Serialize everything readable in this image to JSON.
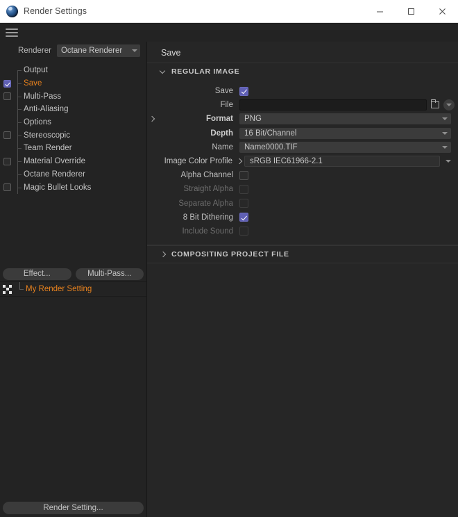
{
  "window": {
    "title": "Render Settings",
    "logo_icon": "cinema4d-logo-icon",
    "minimize_icon": "minimize-icon",
    "maximize_icon": "maximize-icon",
    "close_icon": "close-icon",
    "menu_icon": "hamburger-menu-icon"
  },
  "renderer": {
    "label": "Renderer",
    "value": "Octane Renderer",
    "caret_icon": "chevron-down-icon"
  },
  "tree": {
    "items": [
      {
        "label": "Output",
        "checkbox": "none",
        "active": false
      },
      {
        "label": "Save",
        "checkbox": "checked",
        "active": true
      },
      {
        "label": "Multi-Pass",
        "checkbox": "unchecked",
        "active": false
      },
      {
        "label": "Anti-Aliasing",
        "checkbox": "none",
        "active": false
      },
      {
        "label": "Options",
        "checkbox": "none",
        "active": false
      },
      {
        "label": "Stereoscopic",
        "checkbox": "unchecked",
        "active": false
      },
      {
        "label": "Team Render",
        "checkbox": "none",
        "active": false
      },
      {
        "label": "Material Override",
        "checkbox": "unchecked",
        "active": false
      },
      {
        "label": "Octane Renderer",
        "checkbox": "none",
        "active": false
      },
      {
        "label": "Magic Bullet Looks",
        "checkbox": "unchecked",
        "active": false
      }
    ]
  },
  "left_buttons": {
    "effect": "Effect...",
    "multipass": "Multi-Pass..."
  },
  "render_setting": {
    "name": "My Render Setting",
    "icon": "render-setting-icon",
    "accent_color": "#e8821e"
  },
  "bottom_button": {
    "label": "Render Setting..."
  },
  "main": {
    "title": "Save",
    "sections": [
      {
        "label": "REGULAR IMAGE",
        "expanded": true
      },
      {
        "label": "COMPOSITING PROJECT FILE",
        "expanded": false
      }
    ],
    "fields": {
      "save": {
        "label": "Save",
        "checked": true
      },
      "file": {
        "label": "File",
        "value": "",
        "placeholder": "",
        "folder_icon": "folder-icon",
        "caret_icon": "chevron-down-icon"
      },
      "format": {
        "label": "Format",
        "value": "PNG",
        "expandable": true
      },
      "depth": {
        "label": "Depth",
        "value": "16 Bit/Channel"
      },
      "name": {
        "label": "Name",
        "value": "Name0000.TIF"
      },
      "color_profile": {
        "label": "Image Color Profile",
        "value": "sRGB IEC61966-2.1",
        "expandable": true
      },
      "alpha_channel": {
        "label": "Alpha Channel",
        "checked": false,
        "disabled": false
      },
      "straight_alpha": {
        "label": "Straight Alpha",
        "checked": false,
        "disabled": true
      },
      "separate_alpha": {
        "label": "Separate Alpha",
        "checked": false,
        "disabled": true
      },
      "dithering": {
        "label": "8 Bit Dithering",
        "checked": true,
        "disabled": false
      },
      "include_sound": {
        "label": "Include Sound",
        "checked": false,
        "disabled": true
      }
    }
  },
  "colors": {
    "accent": "#e8821e",
    "checkbox_on": "#5f5fb4",
    "panel_bg": "#262626",
    "sidebar_bg": "#232323"
  }
}
